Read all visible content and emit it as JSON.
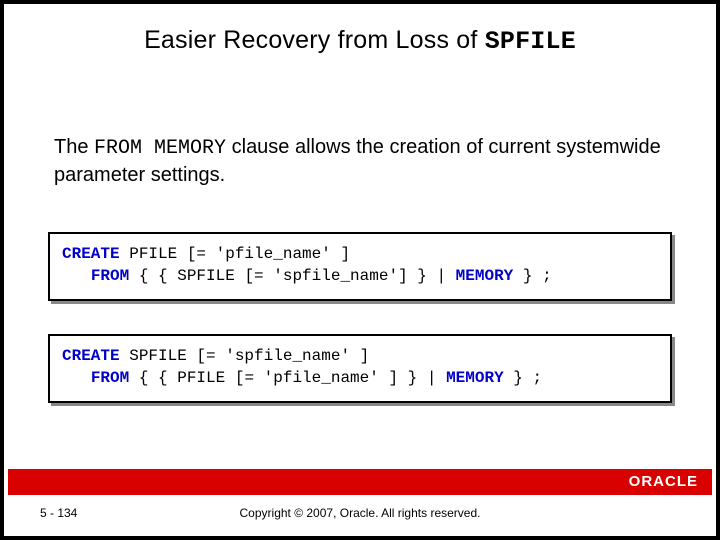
{
  "title": {
    "prefix": "Easier Recovery from Loss of ",
    "mono": "SPFILE"
  },
  "body": {
    "pre1": "The ",
    "mono": "FROM MEMORY",
    "post1": " clause allows the creation of current systemwide parameter settings."
  },
  "code1": {
    "kw_create": "CREATE",
    "t1": " PFILE [= 'pfile_name' ]",
    "kw_from": "FROM",
    "t2": " { { SPFILE [= 'spfile_name'] } | ",
    "kw_memory": "MEMORY",
    "t3": " } ;"
  },
  "code2": {
    "kw_create": "CREATE",
    "t1": " SPFILE [= 'spfile_name' ]",
    "kw_from": "FROM",
    "t2": " { { PFILE [= 'pfile_name' ] } | ",
    "kw_memory": "MEMORY",
    "t3": " } ;"
  },
  "footer": {
    "page": "5 - 134",
    "copyright": "Copyright © 2007, Oracle. All rights reserved.",
    "logo_text": "ORACLE"
  },
  "colors": {
    "accent_red": "#d90000",
    "keyword_blue": "#0000c8"
  }
}
